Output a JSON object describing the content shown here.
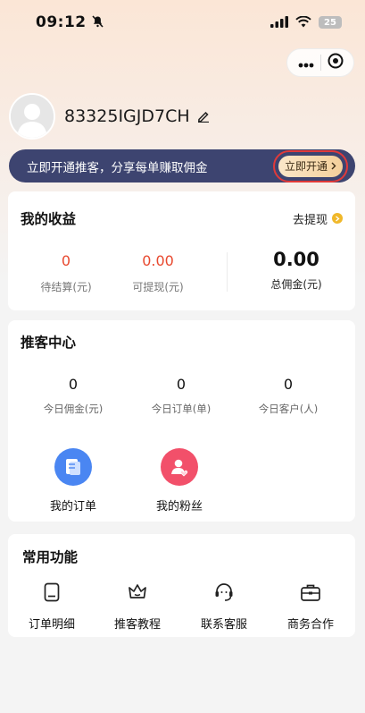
{
  "status_bar": {
    "time": "09:12",
    "battery": "25"
  },
  "profile": {
    "username": "83325IGJD7CH"
  },
  "promo": {
    "text": "立即开通推客，分享每单赚取佣金",
    "button": "立即开通"
  },
  "earnings": {
    "title": "我的收益",
    "withdraw_link": "去提现",
    "pending": {
      "value": "0",
      "label": "待结算(元)"
    },
    "withdrawable": {
      "value": "0.00",
      "label": "可提现(元)"
    },
    "total": {
      "value": "0.00",
      "label": "总佣金(元)"
    }
  },
  "promoter_center": {
    "title": "推客中心",
    "stats": [
      {
        "value": "0",
        "label": "今日佣金(元)"
      },
      {
        "value": "0",
        "label": "今日订单(单)"
      },
      {
        "value": "0",
        "label": "今日客户(人)"
      }
    ],
    "quick": [
      {
        "label": "我的订单",
        "icon": "order-icon",
        "color": "#4a86f2"
      },
      {
        "label": "我的粉丝",
        "icon": "fans-icon",
        "color": "#f2506a"
      }
    ]
  },
  "functions": {
    "title": "常用功能",
    "items": [
      {
        "label": "订单明细",
        "icon": "order-detail-icon"
      },
      {
        "label": "推客教程",
        "icon": "crown-icon"
      },
      {
        "label": "联系客服",
        "icon": "headset-icon"
      },
      {
        "label": "商务合作",
        "icon": "briefcase-icon"
      }
    ]
  }
}
